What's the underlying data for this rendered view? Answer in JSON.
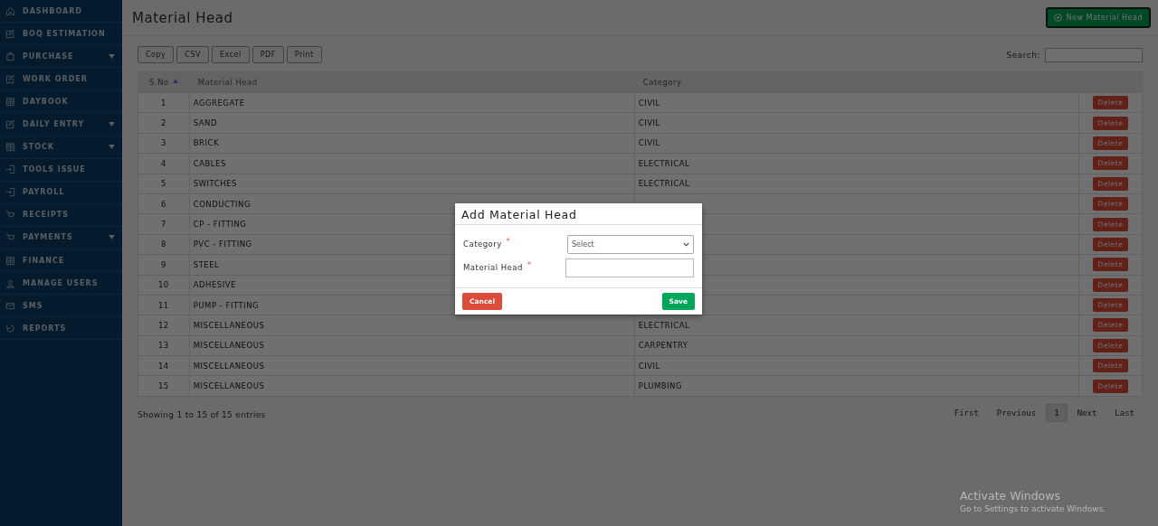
{
  "sidebar": {
    "items": [
      {
        "label": "DASHBOARD",
        "expandable": false
      },
      {
        "label": "BOQ ESTIMATION",
        "expandable": false
      },
      {
        "label": "PURCHASE",
        "expandable": true
      },
      {
        "label": "WORK ORDER",
        "expandable": false
      },
      {
        "label": "DAYBOOK",
        "expandable": false
      },
      {
        "label": "DAILY ENTRY",
        "expandable": true
      },
      {
        "label": "STOCK",
        "expandable": true
      },
      {
        "label": "TOOLS ISSUE",
        "expandable": false
      },
      {
        "label": "PAYROLL",
        "expandable": false
      },
      {
        "label": "RECEIPTS",
        "expandable": false
      },
      {
        "label": "PAYMENTS",
        "expandable": true
      },
      {
        "label": "FINANCE",
        "expandable": false
      },
      {
        "label": "MANAGE USERS",
        "expandable": false
      },
      {
        "label": "SMS",
        "expandable": false
      },
      {
        "label": "REPORTS",
        "expandable": false
      }
    ]
  },
  "page": {
    "title": "Material Head",
    "new_button": "New Material Head"
  },
  "export_buttons": [
    "Copy",
    "CSV",
    "Excel",
    "PDF",
    "Print"
  ],
  "search": {
    "label": "Search:"
  },
  "table": {
    "columns": [
      "S.No",
      "Material Head",
      "Category"
    ],
    "rows": [
      {
        "sno": "1",
        "material_head": "AGGREGATE",
        "category": "CIVIL",
        "action": "Delete"
      },
      {
        "sno": "2",
        "material_head": "SAND",
        "category": "CIVIL",
        "action": "Delete"
      },
      {
        "sno": "3",
        "material_head": "BRICK",
        "category": "CIVIL",
        "action": "Delete"
      },
      {
        "sno": "4",
        "material_head": "CABLES",
        "category": "ELECTRICAL",
        "action": "Delete"
      },
      {
        "sno": "5",
        "material_head": "SWITCHES",
        "category": "ELECTRICAL",
        "action": "Delete"
      },
      {
        "sno": "6",
        "material_head": "CONDUCTING",
        "action": "Delete"
      },
      {
        "sno": "7",
        "material_head": "CP - FITTING",
        "action": "Delete"
      },
      {
        "sno": "8",
        "material_head": "PVC - FITTING",
        "action": "Delete"
      },
      {
        "sno": "9",
        "material_head": "STEEL",
        "action": "Delete"
      },
      {
        "sno": "10",
        "material_head": "ADHESIVE",
        "action": "Delete"
      },
      {
        "sno": "11",
        "material_head": "PUMP - FITTING",
        "action": "Delete"
      },
      {
        "sno": "12",
        "material_head": "MISCELLANEOUS",
        "category": "ELECTRICAL",
        "action": "Delete"
      },
      {
        "sno": "13",
        "material_head": "MISCELLANEOUS",
        "category": "CARPENTRY",
        "action": "Delete"
      },
      {
        "sno": "14",
        "material_head": "MISCELLANEOUS",
        "category": "CIVIL",
        "action": "Delete"
      },
      {
        "sno": "15",
        "material_head": "MISCELLANEOUS",
        "category": "PLUMBING",
        "action": "Delete"
      }
    ]
  },
  "info": "Showing 1 to 15 of 15 entries",
  "pagination": [
    {
      "label": "First",
      "selected": false
    },
    {
      "label": "Previous",
      "selected": false
    },
    {
      "label": "1",
      "selected": true
    },
    {
      "label": "Next",
      "selected": false
    },
    {
      "label": "Last",
      "selected": false
    }
  ],
  "modal": {
    "title": "Add Material Head",
    "required_mark": "*",
    "fields": [
      {
        "kind": "select",
        "label": "Category",
        "required": true,
        "value": "Select"
      },
      {
        "kind": "text",
        "label": "Material Head",
        "required": true
      }
    ],
    "cancel": "Cancel",
    "save": "Save"
  },
  "os_notice": {
    "title": "Activate Windows",
    "text": "Go to Settings to activate Windows."
  }
}
